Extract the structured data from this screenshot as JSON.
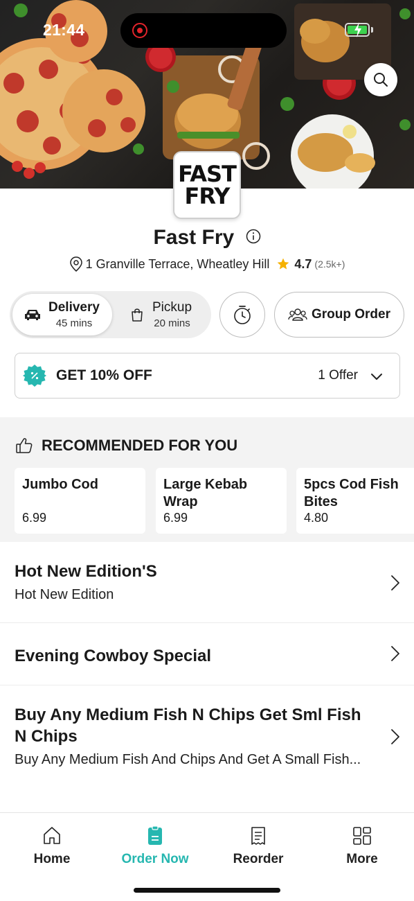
{
  "status_bar": {
    "time": "21:44"
  },
  "hero": {
    "logo_lines": [
      "FAST",
      "FRY"
    ]
  },
  "store": {
    "name": "Fast Fry",
    "address": "1 Granville Terrace, Wheatley Hill",
    "rating": "4.7",
    "rating_count": "(2.5k+)"
  },
  "modes": {
    "delivery": {
      "label": "Delivery",
      "time": "45 mins"
    },
    "pickup": {
      "label": "Pickup",
      "time": "20 mins"
    },
    "group_order_label": "Group Order"
  },
  "offer": {
    "title": "GET 10% OFF",
    "count": "1 Offer"
  },
  "recommended": {
    "title": "RECOMMENDED FOR YOU",
    "items": [
      {
        "name": "Jumbo Cod",
        "price": "6.99"
      },
      {
        "name": "Large Kebab Wrap",
        "price": "6.99"
      },
      {
        "name": "5pcs Cod Fish Bites",
        "price": "4.80"
      }
    ]
  },
  "categories": [
    {
      "title": "Hot New Edition'S",
      "subtitle": "Hot New Edition"
    },
    {
      "title": "Evening Cowboy Special",
      "subtitle": ""
    },
    {
      "title": "Buy Any Medium Fish N Chips Get Sml Fish N Chips",
      "subtitle": "Buy Any Medium Fish And  Chips And Get A Small Fish..."
    }
  ],
  "tabs": [
    {
      "label": "Home",
      "icon": "home-icon"
    },
    {
      "label": "Order Now",
      "icon": "order-icon"
    },
    {
      "label": "Reorder",
      "icon": "receipt-icon"
    },
    {
      "label": "More",
      "icon": "grid-icon"
    }
  ],
  "colors": {
    "accent": "#26b7b0",
    "star": "#f5b100"
  }
}
